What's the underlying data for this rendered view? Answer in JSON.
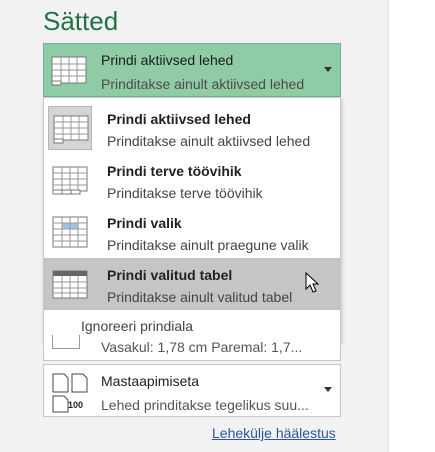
{
  "title": "Sätted",
  "print_what": {
    "selected_label": "Prindi aktiivsed lehed",
    "selected_desc": "Prinditakse ainult aktiivsed lehed",
    "options": [
      {
        "label": "Prindi aktiivsed lehed",
        "desc": "Prinditakse ainult aktiivsed lehed",
        "icon": "active-sheets-icon"
      },
      {
        "label": "Prindi terve töövihik",
        "desc": "Prinditakse terve töövihik",
        "icon": "entire-workbook-icon"
      },
      {
        "label": "Prindi valik",
        "desc": "Prinditakse ainult praegune valik",
        "icon": "selection-icon"
      },
      {
        "label": "Prindi valitud tabel",
        "desc": "Prinditakse ainult valitud tabel",
        "icon": "selected-table-icon"
      }
    ],
    "ignore_label": "Ignoreeri prindiala"
  },
  "margins": {
    "text": "Vasakul: 1,78 cm     Paremal: 1,7..."
  },
  "scaling": {
    "label": "Mastaapimiseta",
    "desc": "Lehed prinditakse tegelikus suu...",
    "icon_text": "100"
  },
  "page_setup_link": "Lehekülje häälestus",
  "colors": {
    "accent": "#217346",
    "selected_combo": "#8fcca6",
    "hover_item": "#c5c5c5",
    "link": "#2b579a"
  }
}
